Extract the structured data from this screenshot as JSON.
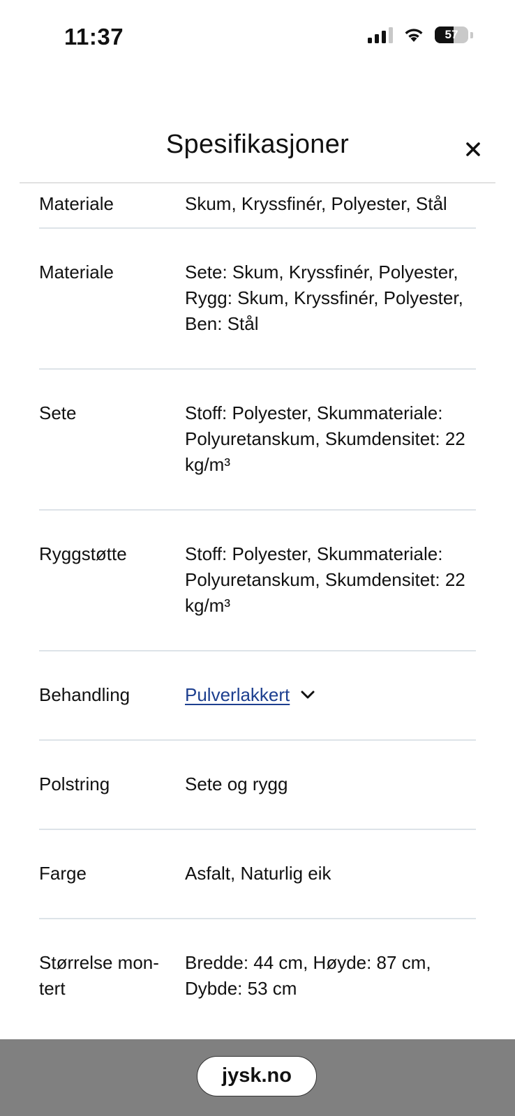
{
  "status_bar": {
    "time": "11:37",
    "battery_level": "57",
    "battery_fraction": 0.57
  },
  "header": {
    "title": "Spesifikasjoner",
    "close_icon": "close-icon"
  },
  "specs": [
    {
      "label": "Materiale",
      "value": "Skum, Kryssfinér, Polyester, Stål"
    },
    {
      "label": "Materiale",
      "value": "Sete: Skum, Kryssfinér, Polyester, Rygg: Skum, Kryssfinér, Polyester, Ben: Stål"
    },
    {
      "label": "Sete",
      "value": "Stoff: Polyester, Skummateriale: Polyuretanskum, Skumdensitet: 22 kg/m³"
    },
    {
      "label": "Ryggstøtte",
      "value": "Stoff: Polyester, Skummateriale: Polyuretanskum, Skumdensitet: 22 kg/m³"
    },
    {
      "label": "Behandling",
      "value": "Pulverlakkert"
    },
    {
      "label": "Polstring",
      "value": "Sete og rygg"
    },
    {
      "label": "Farge",
      "value": "Asfalt, Naturlig eik"
    },
    {
      "label": "Størrelse mon-tert",
      "value": "Bredde: 44 cm, Høyde: 87 cm, Dybde: 53 cm"
    }
  ],
  "browser": {
    "url": "jysk.no"
  },
  "colors": {
    "link": "#1d3f8f",
    "divider": "#dde3e8",
    "browser_bar": "#808080"
  }
}
